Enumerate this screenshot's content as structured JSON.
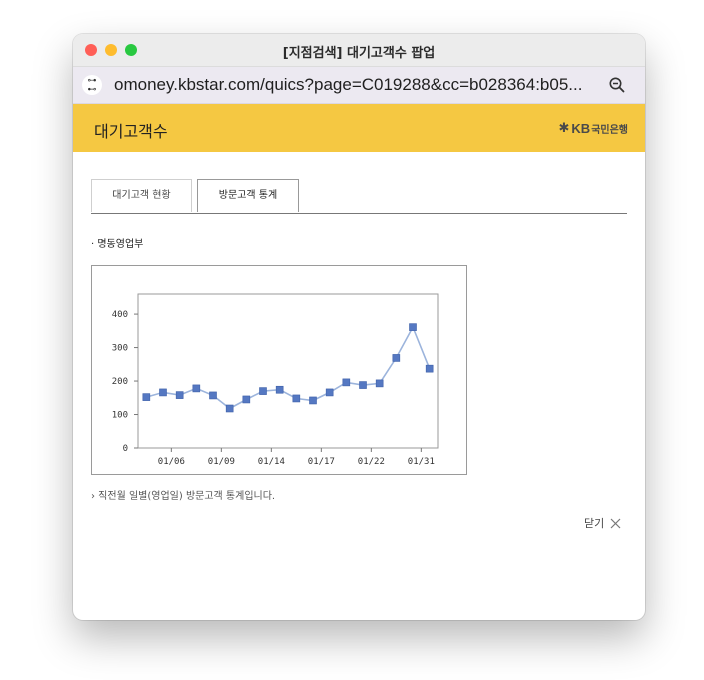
{
  "window": {
    "title": "[지점검색] 대기고객수 팝업"
  },
  "address_bar": {
    "url": "omoney.kbstar.com/quics?page=C019288&cc=b028364:b05...",
    "site_icon": "tune-icon",
    "zoom_icon": "zoom-out-icon"
  },
  "header": {
    "title": "대기고객수",
    "logo_star": "✱",
    "logo_text": "KB",
    "logo_bank": "국민은행",
    "brand_color": "#f5c842"
  },
  "tabs": [
    {
      "label": "대기고객 현황",
      "active": false
    },
    {
      "label": "방문고객 통계",
      "active": true
    }
  ],
  "branch": {
    "label": "· 명동영업부"
  },
  "chart_data": {
    "type": "line",
    "x_ticks": [
      "01/06",
      "01/09",
      "01/14",
      "01/17",
      "01/22",
      "01/31"
    ],
    "tick_positions": [
      2.5,
      5.5,
      8.5,
      11.5,
      14.5,
      17.5
    ],
    "x": [
      1,
      2,
      3,
      4,
      5,
      6,
      7,
      8,
      9,
      10,
      11,
      12,
      13,
      14,
      15,
      16,
      17,
      18
    ],
    "values": [
      152,
      166,
      158,
      178,
      157,
      118,
      145,
      170,
      174,
      148,
      142,
      166,
      196,
      188,
      193,
      269,
      361,
      237
    ],
    "xlim": [
      0.5,
      18.5
    ],
    "ylim": [
      0,
      460
    ],
    "yticks": [
      0,
      100,
      200,
      300,
      400
    ],
    "grid": false,
    "line_color": "#9cb4dc",
    "marker_color": "#5578c2"
  },
  "note": "› 직전월 일별(영업일) 방문고객 통계입니다.",
  "close": {
    "label": "닫기",
    "icon": "close-icon"
  }
}
